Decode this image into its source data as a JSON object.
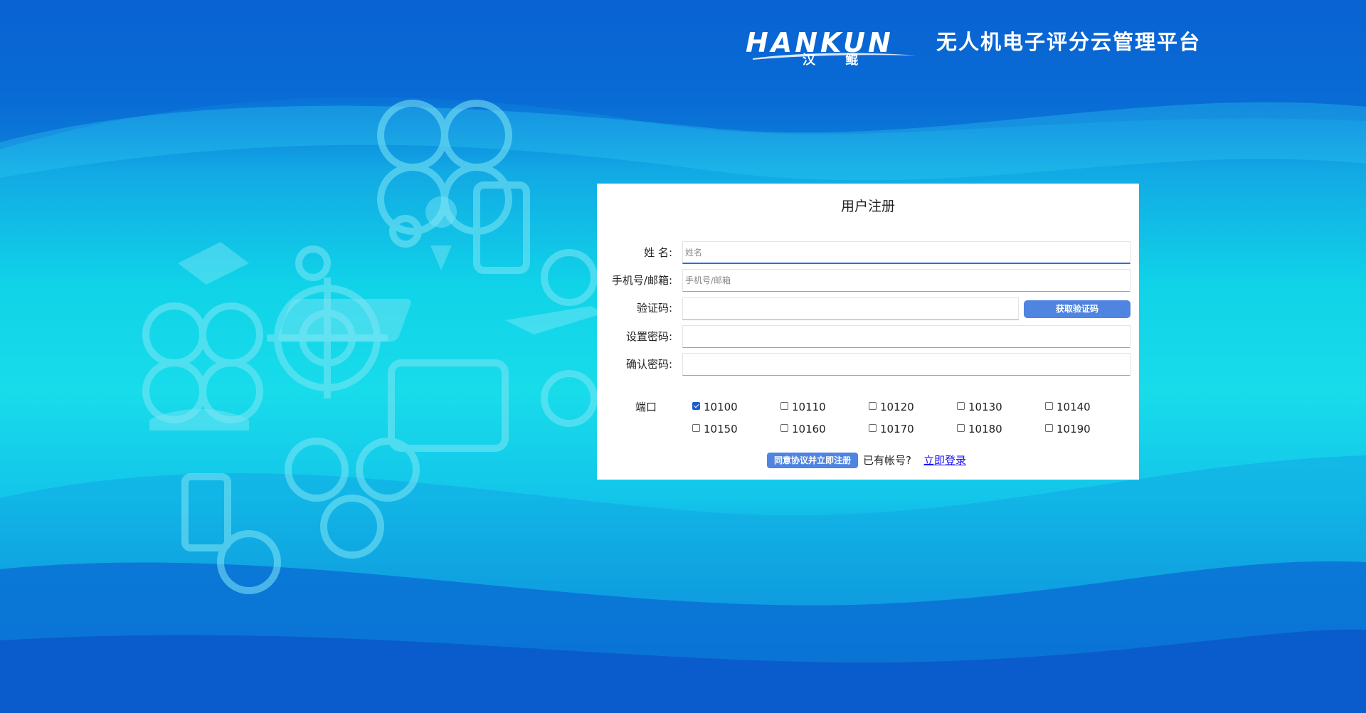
{
  "header": {
    "logo_text": "HANKUN",
    "logo_cn": "汉 鲲",
    "title": "无人机电子评分云管理平台"
  },
  "form": {
    "title": "用户注册",
    "name": {
      "label": "姓 名:",
      "placeholder": "姓名",
      "value": ""
    },
    "phone": {
      "label": "手机号/邮箱:",
      "placeholder": "手机号/邮箱",
      "value": ""
    },
    "code": {
      "label": "验证码:",
      "value": "",
      "button": "获取验证码"
    },
    "password": {
      "label": "设置密码:",
      "value": ""
    },
    "confirm": {
      "label": "确认密码:",
      "value": ""
    },
    "ports_label": "端口",
    "ports": [
      {
        "label": "10100",
        "checked": true
      },
      {
        "label": "10110",
        "checked": false
      },
      {
        "label": "10120",
        "checked": false
      },
      {
        "label": "10130",
        "checked": false
      },
      {
        "label": "10140",
        "checked": false
      },
      {
        "label": "10150",
        "checked": false
      },
      {
        "label": "10160",
        "checked": false
      },
      {
        "label": "10170",
        "checked": false
      },
      {
        "label": "10180",
        "checked": false
      },
      {
        "label": "10190",
        "checked": false
      }
    ],
    "submit": "同意协议并立即注册",
    "have_account": "已有帐号?",
    "login_link": "立即登录"
  },
  "colors": {
    "accent": "#4f84e0",
    "link": "#1a0dff",
    "checkbox_checked": "#1a5fcc"
  }
}
